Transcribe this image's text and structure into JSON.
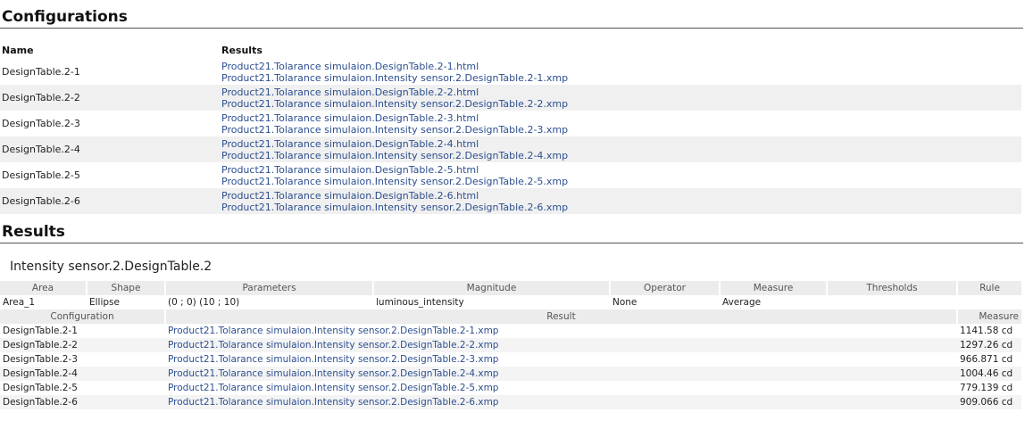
{
  "configurations": {
    "heading": "Configurations",
    "columns": {
      "name": "Name",
      "results": "Results"
    },
    "rows": [
      {
        "name": "DesignTable.2-1",
        "html": "Product21.Tolarance simulaion.DesignTable.2-1.html",
        "xmp": "Product21.Tolarance simulaion.Intensity sensor.2.DesignTable.2-1.xmp"
      },
      {
        "name": "DesignTable.2-2",
        "html": "Product21.Tolarance simulaion.DesignTable.2-2.html",
        "xmp": "Product21.Tolarance simulaion.Intensity sensor.2.DesignTable.2-2.xmp"
      },
      {
        "name": "DesignTable.2-3",
        "html": "Product21.Tolarance simulaion.DesignTable.2-3.html",
        "xmp": "Product21.Tolarance simulaion.Intensity sensor.2.DesignTable.2-3.xmp"
      },
      {
        "name": "DesignTable.2-4",
        "html": "Product21.Tolarance simulaion.DesignTable.2-4.html",
        "xmp": "Product21.Tolarance simulaion.Intensity sensor.2.DesignTable.2-4.xmp"
      },
      {
        "name": "DesignTable.2-5",
        "html": "Product21.Tolarance simulaion.DesignTable.2-5.html",
        "xmp": "Product21.Tolarance simulaion.Intensity sensor.2.DesignTable.2-5.xmp"
      },
      {
        "name": "DesignTable.2-6",
        "html": "Product21.Tolarance simulaion.DesignTable.2-6.html",
        "xmp": "Product21.Tolarance simulaion.Intensity sensor.2.DesignTable.2-6.xmp"
      }
    ]
  },
  "results": {
    "heading": "Results",
    "sensor_title": "Intensity sensor.2.DesignTable.2",
    "area_columns": {
      "area": "Area",
      "shape": "Shape",
      "parameters": "Parameters",
      "magnitude": "Magnitude",
      "operator": "Operator",
      "measure": "Measure",
      "thresholds": "Thresholds",
      "rule": "Rule"
    },
    "area_row": {
      "area": "Area_1",
      "shape": "Ellipse",
      "parameters": "(0 ; 0) (10 ; 10)",
      "magnitude": "luminous_intensity",
      "operator": "None",
      "measure": "Average",
      "thresholds": "",
      "rule": ""
    },
    "result_columns": {
      "configuration": "Configuration",
      "result": "Result",
      "measure": "Measure"
    },
    "result_rows": [
      {
        "configuration": "DesignTable.2-1",
        "result": "Product21.Tolarance simulaion.Intensity sensor.2.DesignTable.2-1.xmp",
        "measure": "1141.58 cd"
      },
      {
        "configuration": "DesignTable.2-2",
        "result": "Product21.Tolarance simulaion.Intensity sensor.2.DesignTable.2-2.xmp",
        "measure": "1297.26 cd"
      },
      {
        "configuration": "DesignTable.2-3",
        "result": "Product21.Tolarance simulaion.Intensity sensor.2.DesignTable.2-3.xmp",
        "measure": "966.871 cd"
      },
      {
        "configuration": "DesignTable.2-4",
        "result": "Product21.Tolarance simulaion.Intensity sensor.2.DesignTable.2-4.xmp",
        "measure": "1004.46 cd"
      },
      {
        "configuration": "DesignTable.2-5",
        "result": "Product21.Tolarance simulaion.Intensity sensor.2.DesignTable.2-5.xmp",
        "measure": "779.139 cd"
      },
      {
        "configuration": "DesignTable.2-6",
        "result": "Product21.Tolarance simulaion.Intensity sensor.2.DesignTable.2-6.xmp",
        "measure": "909.066 cd"
      }
    ]
  },
  "colors": {
    "link": "#2d4f8f",
    "stripe": "#f0f0f0",
    "header_bg": "#ececec"
  }
}
